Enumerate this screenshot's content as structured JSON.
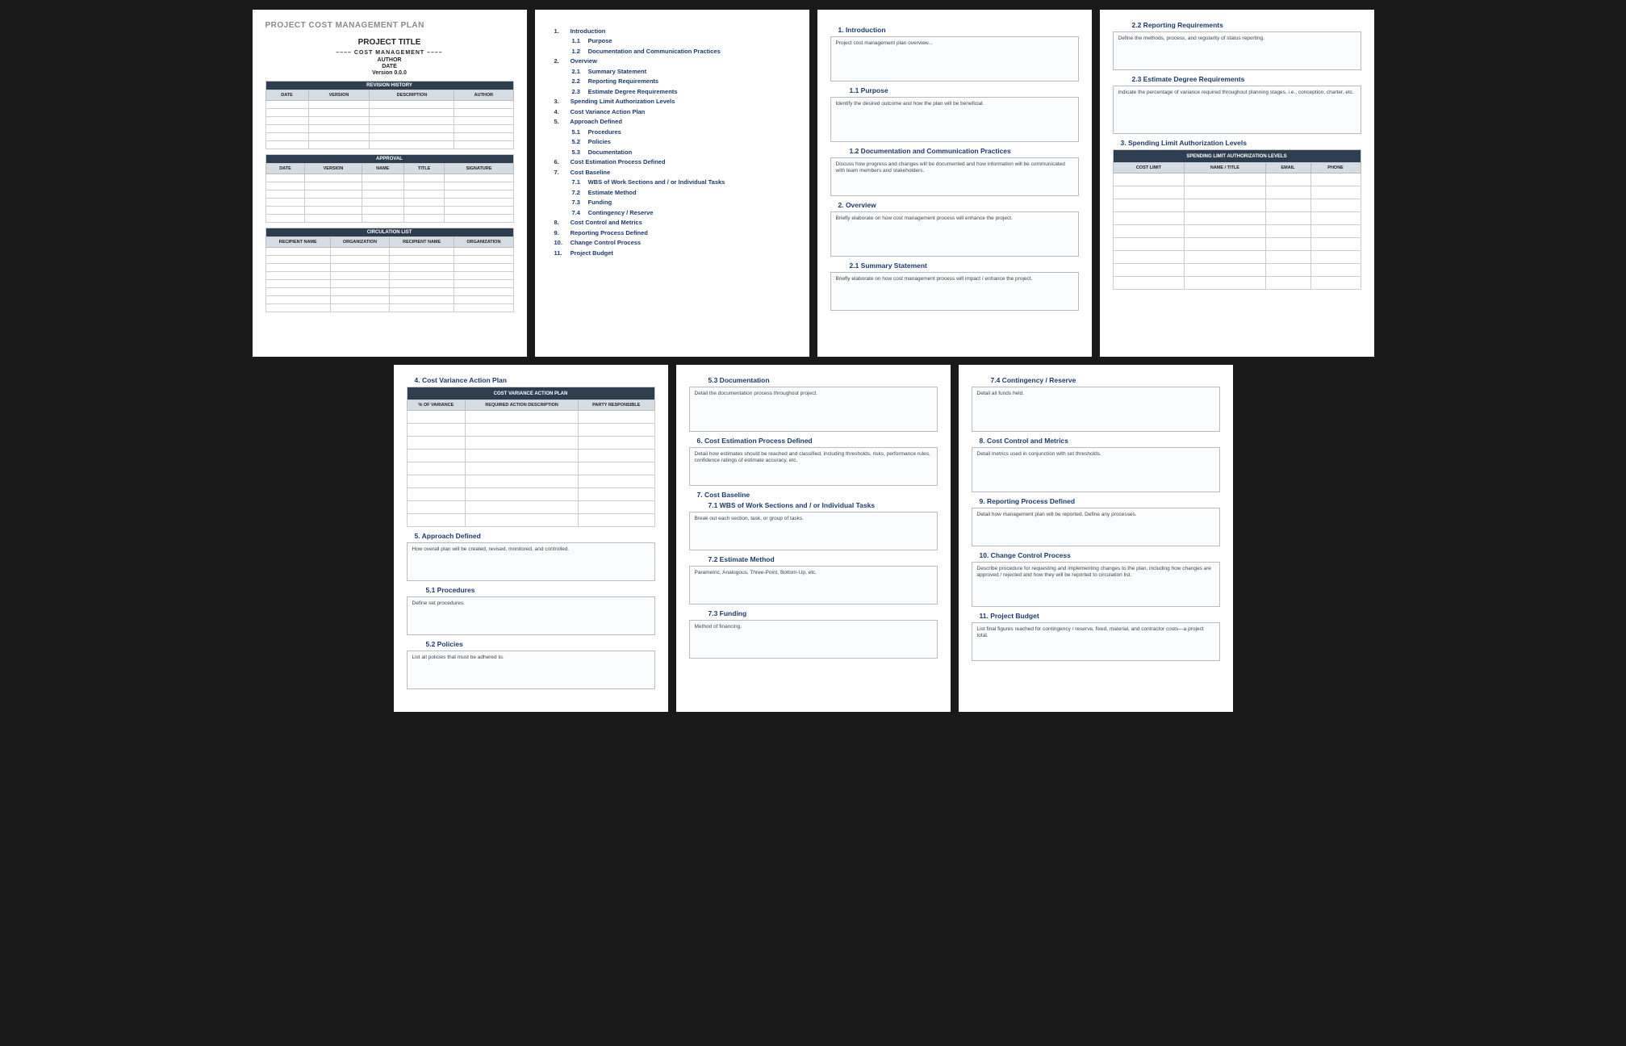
{
  "docTitle": "PROJECT COST MANAGEMENT PLAN",
  "cover": {
    "title": "PROJECT TITLE",
    "sub": "––––   COST MANAGEMENT   ––––",
    "author": "AUTHOR",
    "date": "DATE",
    "version": "Version 0.0.0"
  },
  "tables": {
    "revision": {
      "title": "REVISION HISTORY",
      "cols": [
        "DATE",
        "VERSION",
        "DESCRIPTION",
        "AUTHOR"
      ],
      "rows": 6
    },
    "approval": {
      "title": "APPROVAL",
      "cols": [
        "DATE",
        "VERSION",
        "NAME",
        "TITLE",
        "SIGNATURE"
      ],
      "rows": 6
    },
    "circulation": {
      "title": "CIRCULATION LIST",
      "cols": [
        "RECIPIENT NAME",
        "ORGANIZATION",
        "RECIPIENT NAME",
        "ORGANIZATION"
      ],
      "rows": 8
    },
    "variance": {
      "title": "COST VARIANCE ACTION PLAN",
      "cols": [
        "% OF VARIANCE",
        "REQUIRED ACTION DESCRIPTION",
        "PARTY RESPONSIBLE"
      ],
      "rows": 9
    },
    "spending": {
      "title": "SPENDING LIMIT AUTHORIZATION LEVELS",
      "cols": [
        "COST LIMIT",
        "NAME / TITLE",
        "EMAIL",
        "PHONE"
      ],
      "rows": 9
    }
  },
  "toc": [
    {
      "n": "1.",
      "t": "Introduction",
      "subs": [
        {
          "n": "1.1",
          "t": "Purpose"
        },
        {
          "n": "1.2",
          "t": "Documentation and Communication Practices"
        }
      ]
    },
    {
      "n": "2.",
      "t": "Overview",
      "subs": [
        {
          "n": "2.1",
          "t": "Summary Statement"
        },
        {
          "n": "2.2",
          "t": "Reporting Requirements"
        },
        {
          "n": "2.3",
          "t": "Estimate Degree Requirements"
        }
      ]
    },
    {
      "n": "3.",
      "t": "Spending Limit Authorization Levels"
    },
    {
      "n": "4.",
      "t": "Cost Variance Action Plan"
    },
    {
      "n": "5.",
      "t": "Approach Defined",
      "subs": [
        {
          "n": "5.1",
          "t": "Procedures"
        },
        {
          "n": "5.2",
          "t": "Policies"
        },
        {
          "n": "5.3",
          "t": "Documentation"
        }
      ]
    },
    {
      "n": "6.",
      "t": "Cost Estimation Process Defined"
    },
    {
      "n": "7.",
      "t": "Cost Baseline",
      "subs": [
        {
          "n": "7.1",
          "t": "WBS of Work Sections and / or Individual Tasks"
        },
        {
          "n": "7.2",
          "t": "Estimate Method"
        },
        {
          "n": "7.3",
          "t": "Funding"
        },
        {
          "n": "7.4",
          "t": "Contingency / Reserve"
        }
      ]
    },
    {
      "n": "8.",
      "t": "Cost Control and Metrics"
    },
    {
      "n": "9.",
      "t": "Reporting Process Defined"
    },
    {
      "n": "10.",
      "t": "Change Control Process"
    },
    {
      "n": "11.",
      "t": "Project Budget"
    }
  ],
  "secs": {
    "s1": {
      "h": "1. Introduction",
      "d": "Project cost management plan overview..."
    },
    "s11": {
      "h": "1.1   Purpose",
      "d": "Identify the desired outcome and how the plan will be beneficial."
    },
    "s12": {
      "h": "1.2   Documentation and Communication Practices",
      "d": "Discuss how progress and changes will be documented and how information will be communicated with team members and stakeholders."
    },
    "s2": {
      "h": "2. Overview",
      "d": "Briefly elaborate on how cost management process will enhance the project."
    },
    "s21": {
      "h": "2.1   Summary Statement",
      "d": "Briefly elaborate on how cost management process will impact / enhance the project."
    },
    "s22": {
      "h": "2.2   Reporting Requirements",
      "d": "Define the methods, process, and regularity of status reporting."
    },
    "s23": {
      "h": "2.3   Estimate Degree Requirements",
      "d": "Indicate the percentage of variance required throughout planning stages, i.e., conception, charter, etc."
    },
    "s3": {
      "h": "3. Spending Limit Authorization Levels"
    },
    "s4": {
      "h": "4. Cost Variance Action Plan"
    },
    "s5": {
      "h": "5. Approach Defined",
      "d": "How overall plan will be created, revised, monitored, and controlled."
    },
    "s51": {
      "h": "5.1   Procedures",
      "d": "Define set procedures."
    },
    "s52": {
      "h": "5.2   Policies",
      "d": "List all policies that must be adhered to."
    },
    "s53": {
      "h": "5.3   Documentation",
      "d": "Detail the documentation process throughout project."
    },
    "s6": {
      "h": "6. Cost Estimation Process Defined",
      "d": "Detail how estimates should be reached and classified, including thresholds, risks, performance rules, confidence ratings of estimate accuracy, etc."
    },
    "s7": {
      "h": "7. Cost Baseline"
    },
    "s71": {
      "h": "7.1   WBS of Work Sections and / or Individual Tasks",
      "d": "Break out each section, task, or group of tasks."
    },
    "s72": {
      "h": "7.2   Estimate Method",
      "d": "Parametric, Analogous, Three-Point, Bottom-Up, etc."
    },
    "s73": {
      "h": "7.3   Funding",
      "d": "Method of financing."
    },
    "s74": {
      "h": "7.4   Contingency / Reserve",
      "d": "Detail all funds held."
    },
    "s8": {
      "h": "8. Cost Control and Metrics",
      "d": "Detail metrics used in conjunction with set thresholds."
    },
    "s9": {
      "h": "9. Reporting Process Defined",
      "d": "Detail how management plan will be reported. Define any processes."
    },
    "s10": {
      "h": "10. Change Control Process",
      "d": "Describe procedure for requesting and implementing changes to the plan, including how changes are approved / rejected and how they will be reported to circulation list."
    },
    "s11b": {
      "h": "11. Project Budget",
      "d": "List final figures reached for contingency / reserve, fixed, material, and contractor costs—a project total."
    }
  }
}
